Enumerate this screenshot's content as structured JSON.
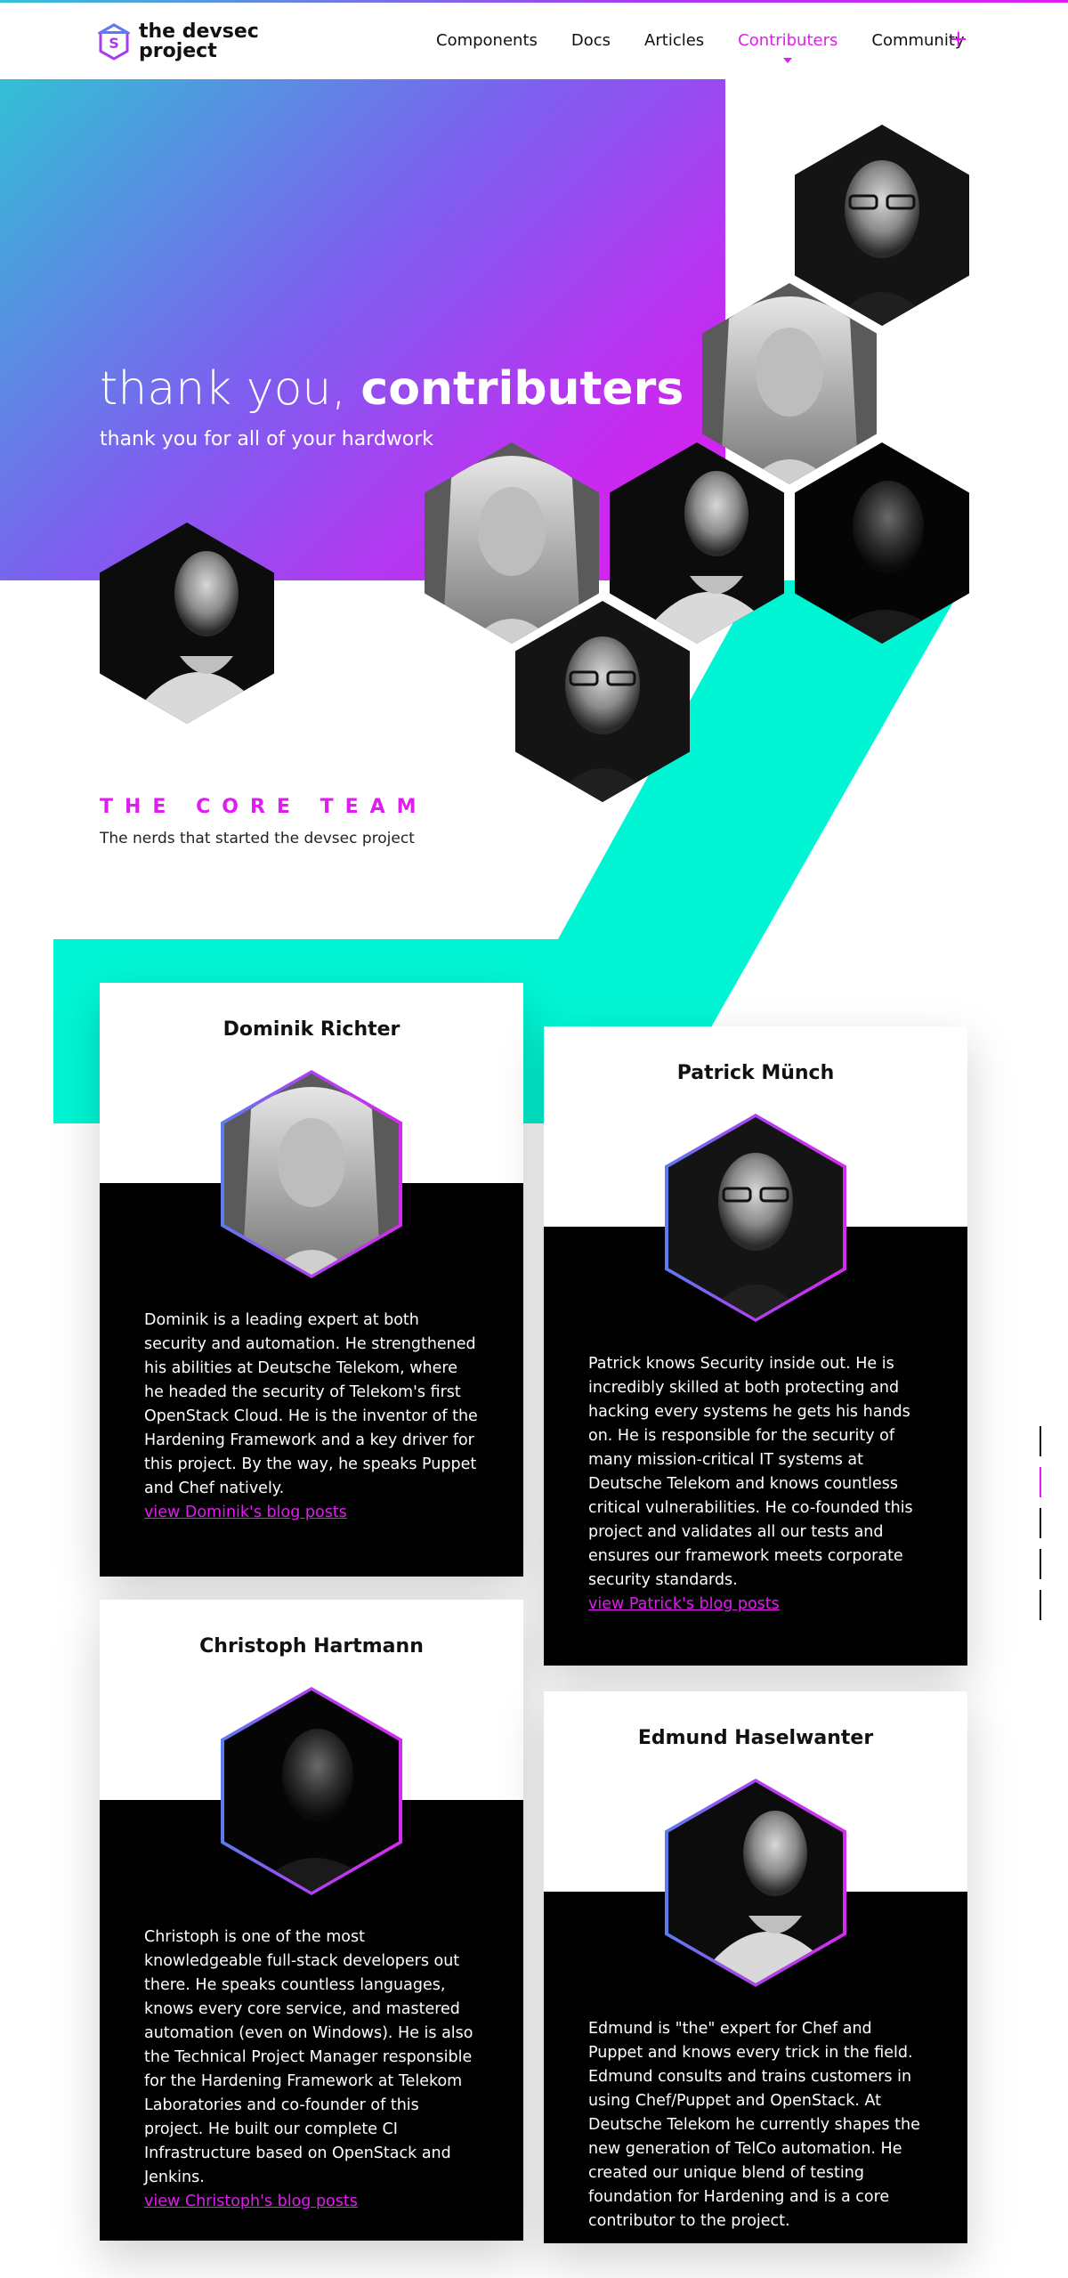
{
  "header": {
    "logo_text": "the devsec\nproject",
    "nav": [
      {
        "label": "Components",
        "active": false
      },
      {
        "label": "Docs",
        "active": false
      },
      {
        "label": "Articles",
        "active": false
      },
      {
        "label": "Contributers",
        "active": true
      },
      {
        "label": "Community",
        "active": false
      }
    ],
    "plus_icon": "+"
  },
  "hero": {
    "title_light": "thank you, ",
    "title_bold": "contributers",
    "subtitle": "thank you for all of your hardwork"
  },
  "section": {
    "title": "THE CORE TEAM",
    "subtitle": "The nerds that started the devsec project"
  },
  "cards": [
    {
      "name": "Dominik Richter",
      "bio": "Dominik is a leading expert at both security and automation. He strengthened his abilities at Deutsche Telekom, where he headed the security of Telekom's first OpenStack Cloud. He is the inventor of the Hardening Framework and a key driver for this project. By the way, he speaks Puppet and Chef natively.",
      "link": "view Dominik's blog posts"
    },
    {
      "name": "Patrick Münch",
      "bio": "Patrick knows Security inside out. He is incredibly skilled at both protecting and hacking every systems he gets his hands on. He is responsible for the security of many mission-critical IT systems at Deutsche Telekom and knows countless critical vulnerabilities. He co-founded this project and validates all our tests and ensures our framework meets corporate security standards.",
      "link": "view Patrick's blog posts"
    },
    {
      "name": "Christoph Hartmann",
      "bio": "Christoph is one of the most knowledgeable full-stack developers out there. He speaks countless languages, knows every core service, and mastered automation (even on Windows). He is also the Technical Project Manager responsible for the Hardening Framework at Telekom Laboratories and co-founder of this project. He built our complete CI Infrastructure based on OpenStack and Jenkins.",
      "link": "view Christoph's blog posts"
    },
    {
      "name": "Edmund Haselwanter",
      "bio": "Edmund is \"the\" expert for Chef and Puppet and knows every trick in the field. Edmund consults and trains customers in using Chef/Puppet and OpenStack. At Deutsche Telekom he currently shapes the new generation of TelCo automation. He created our unique blend of testing foundation for Hardening and is a core contributor to the project.",
      "link": ""
    }
  ],
  "colors": {
    "accent": "#e01cf0",
    "teal": "#00f5d4",
    "hero_start": "#33bfd5",
    "hero_end": "#de20f0"
  }
}
